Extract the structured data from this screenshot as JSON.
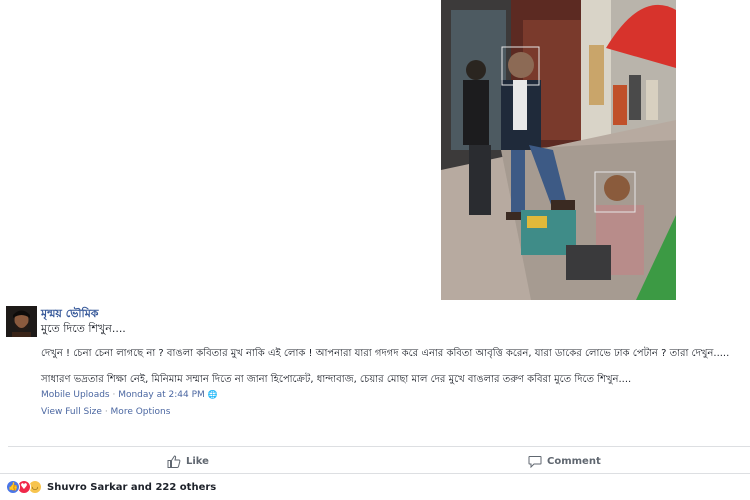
{
  "post": {
    "author": "মৃন্ময় ভৌমিক",
    "subtitle": "মুতে দিতে শিখুন....",
    "paragraph1": "দেখুন ! চেনা চেনা লাগছে না ? বাঙলা কবিতার মুখ নাকি এই লোক ! আপনারা যারা গদগদ করে এনার কবিতা আবৃত্তি করেন, যারা ডাকের লোভে ঢাক পেটান ? তারা দেখুন.....",
    "paragraph2": "সাধারণ ভদ্রতার শিক্ষা নেই, মিনিমাম সম্মান দিতে না জানা হিপোক্রেট, ধান্দাবাজ, চেয়ার মোছা মাল দের মুখে বাঙলার তরুণ কবিরা মুতে দিতে শিখুন....",
    "source": "Mobile Uploads",
    "separator": " · ",
    "timestamp": "Monday at 2:44 PM",
    "globe_symbol": "🌐",
    "view_full_size": "View Full Size",
    "more_options": "More Options"
  },
  "actions": {
    "like_label": "Like",
    "comment_label": "Comment"
  },
  "reactions": {
    "summary": "Shuvro Sarkar and 222 others",
    "icons": [
      "like-reaction-icon",
      "love-reaction-icon",
      "sad-reaction-icon"
    ]
  },
  "colors": {
    "link": "#365899",
    "meta": "#90949c",
    "like_blue": "#4a76e8",
    "love_red": "#f0284a",
    "sad_yellow": "#f7c44e"
  }
}
